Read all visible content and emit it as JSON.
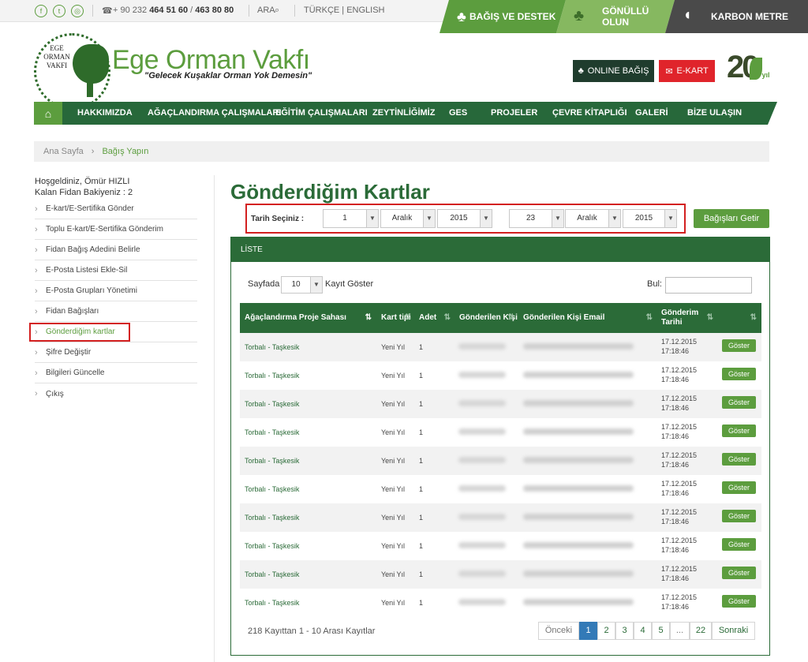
{
  "topbar": {
    "social": [
      "f",
      "t",
      "◎"
    ],
    "phone_prefix": "+ 90 232 ",
    "phone_1": "464 51 60",
    "phone_sep": " / ",
    "phone_2": "463 80 80",
    "search_label": "ARA",
    "lang": "TÜRKÇE | ENGLISH",
    "promo_donate": "BAĞIŞ VE DESTEK",
    "promo_volunteer": "GÖNÜLLÜ OLUN",
    "promo_carbon": "KARBON METRE"
  },
  "header": {
    "logo_text": "EGE ORMAN VAKFI",
    "brand_name": "Ege Orman Vakfı",
    "slogan": "\"Gelecek Kuşaklar Orman Yok Demesin\"",
    "online_donation": "ONLINE BAĞIŞ",
    "ekart": "E-KART",
    "badge_number": "20",
    "badge_suffix": "yıl"
  },
  "nav": {
    "items": [
      "HAKKIMIZDA",
      "AĞAÇLANDIRMA ÇALIŞMALARI",
      "EĞİTİM ÇALIŞMALARI",
      "ZEYTİNLİĞİMİZ",
      "GES",
      "PROJELER",
      "ÇEVRE KİTAPLIĞI",
      "GALERİ",
      "BİZE ULAŞIN"
    ]
  },
  "breadcrumb": {
    "home": "Ana Sayfa",
    "current": "Bağış Yapın"
  },
  "sidebar": {
    "greeting": "Hoşgeldiniz, Ömür HIZLI",
    "balance": "Kalan Fidan Bakiyeniz : 2",
    "items": [
      "E-kart/E-Sertifika Gönder",
      "Toplu E-kart/E-Sertifika Gönderim",
      "Fidan Bağış Adedini Belirle",
      "E-Posta Listesi Ekle-Sil",
      "E-Posta Grupları Yönetimi",
      "Fidan Bağışları",
      "Gönderdiğim kartlar",
      "Şifre Değiştir",
      "Bilgileri Güncelle",
      "Çıkış"
    ]
  },
  "main": {
    "title": "Gönderdiğim Kartlar",
    "date_label": "Tarih Seçiniz :",
    "from_day": "1",
    "from_month": "Aralık",
    "from_year": "2015",
    "to_day": "23",
    "to_month": "Aralık",
    "to_year": "2015",
    "fetch_button": "Bağışları Getir"
  },
  "panel": {
    "title": "LİSTE",
    "page_len_label": "Sayfada",
    "page_len_value": "10",
    "page_len_after": "Kayıt Göster",
    "search_label": "Bul:",
    "columns": [
      "Ağaçlandırma Proje Sahası",
      "Kart tipi",
      "Adet",
      "Gönderilen Kişi",
      "Gönderilen Kişi Email",
      "Gönderim Tarihi"
    ],
    "rows": [
      {
        "site": "Torbalı - Taşkesik",
        "type": "Yeni Yıl",
        "qty": "1",
        "date": "17.12.2015",
        "time": "17:18:46",
        "action": "Göster"
      },
      {
        "site": "Torbalı - Taşkesik",
        "type": "Yeni Yıl",
        "qty": "1",
        "date": "17.12.2015",
        "time": "17:18:46",
        "action": "Göster"
      },
      {
        "site": "Torbalı - Taşkesik",
        "type": "Yeni Yıl",
        "qty": "1",
        "date": "17.12.2015",
        "time": "17:18:46",
        "action": "Göster"
      },
      {
        "site": "Torbalı - Taşkesik",
        "type": "Yeni Yıl",
        "qty": "1",
        "date": "17.12.2015",
        "time": "17:18:46",
        "action": "Göster"
      },
      {
        "site": "Torbalı - Taşkesik",
        "type": "Yeni Yıl",
        "qty": "1",
        "date": "17.12.2015",
        "time": "17:18:46",
        "action": "Göster"
      },
      {
        "site": "Torbalı - Taşkesik",
        "type": "Yeni Yıl",
        "qty": "1",
        "date": "17.12.2015",
        "time": "17:18:46",
        "action": "Göster"
      },
      {
        "site": "Torbalı - Taşkesik",
        "type": "Yeni Yıl",
        "qty": "1",
        "date": "17.12.2015",
        "time": "17:18:46",
        "action": "Göster"
      },
      {
        "site": "Torbalı - Taşkesik",
        "type": "Yeni Yıl",
        "qty": "1",
        "date": "17.12.2015",
        "time": "17:18:46",
        "action": "Göster"
      },
      {
        "site": "Torbalı - Taşkesik",
        "type": "Yeni Yıl",
        "qty": "1",
        "date": "17.12.2015",
        "time": "17:18:46",
        "action": "Göster"
      },
      {
        "site": "Torbalı - Taşkesik",
        "type": "Yeni Yıl",
        "qty": "1",
        "date": "17.12.2015",
        "time": "17:18:46",
        "action": "Göster"
      }
    ],
    "info": "218 Kayıttan 1 - 10 Arası Kayıtlar",
    "pagination": {
      "prev": "Önceki",
      "pages": [
        "1",
        "2",
        "3",
        "4",
        "5",
        "...",
        "22"
      ],
      "next": "Sonraki"
    }
  }
}
